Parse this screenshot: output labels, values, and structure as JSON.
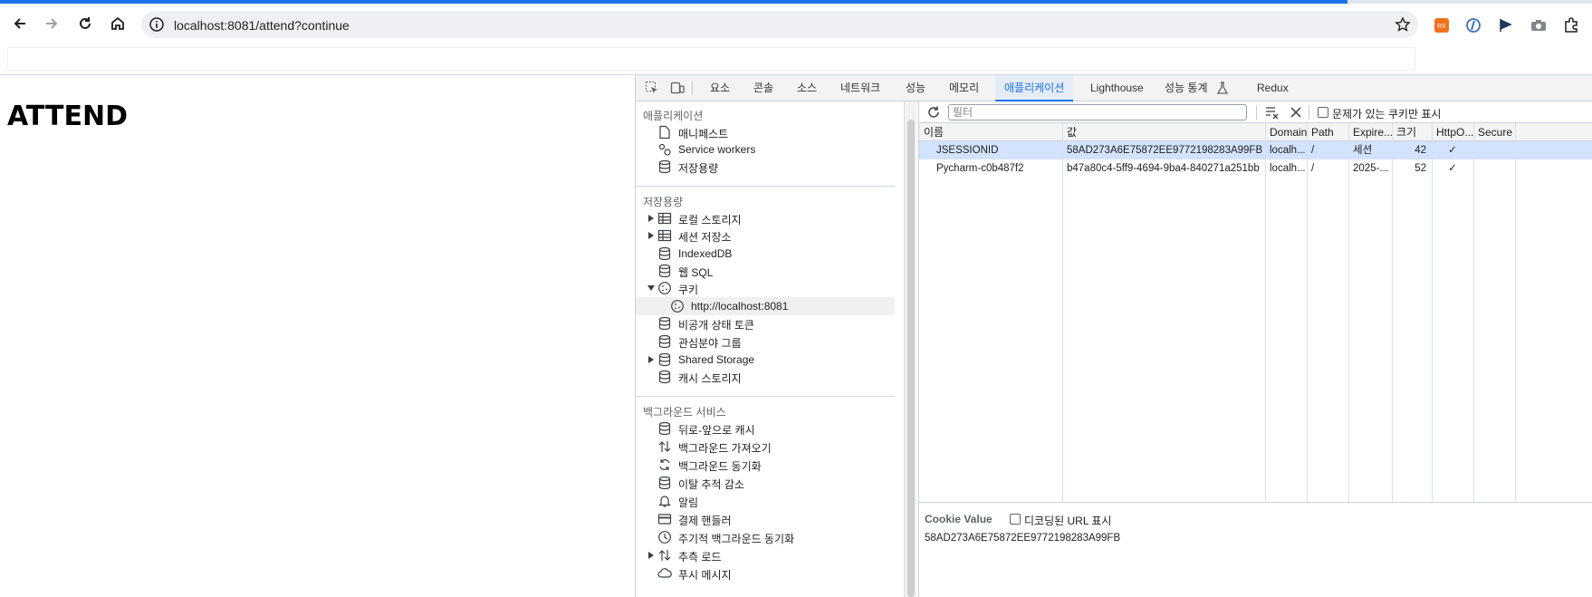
{
  "browser": {
    "url": "localhost:8081/attend?continue",
    "icons": [
      "back-icon",
      "forward-icon",
      "reload-icon",
      "home-icon",
      "info-icon",
      "star-icon",
      "extension-icons",
      "puzzle-icon"
    ]
  },
  "page": {
    "heading": "ATTEND"
  },
  "devtools": {
    "tabs": [
      "요소",
      "콘솔",
      "소스",
      "네트워크",
      "성능",
      "메모리",
      "애플리케이션",
      "Lighthouse",
      "성능 통계",
      "Redux"
    ],
    "active_tab": "애플리케이션",
    "sidebar": {
      "sections": [
        {
          "title": "애플리케이션",
          "items": [
            {
              "label": "매니페스트",
              "icon": "file-icon"
            },
            {
              "label": "Service workers",
              "icon": "gears-icon"
            },
            {
              "label": "저장용량",
              "icon": "database-icon"
            }
          ]
        },
        {
          "title": "저장용량",
          "items": [
            {
              "label": "로컬 스토리지",
              "icon": "table-icon",
              "expandable": true
            },
            {
              "label": "세션 저장소",
              "icon": "table-icon",
              "expandable": true
            },
            {
              "label": "IndexedDB",
              "icon": "database-icon"
            },
            {
              "label": "웹 SQL",
              "icon": "database-icon"
            },
            {
              "label": "쿠키",
              "icon": "cookie-icon",
              "expanded": true
            },
            {
              "label": "http://localhost:8081",
              "icon": "cookie-icon",
              "child": true,
              "selected": true
            },
            {
              "label": "비공개 상태 토큰",
              "icon": "database-icon"
            },
            {
              "label": "관심분야 그룹",
              "icon": "database-icon"
            },
            {
              "label": "Shared Storage",
              "icon": "database-icon",
              "expandable": true
            },
            {
              "label": "캐시 스토리지",
              "icon": "database-icon"
            }
          ]
        },
        {
          "title": "백그라운드 서비스",
          "items": [
            {
              "label": "뒤로-앞으로 캐시",
              "icon": "database-icon"
            },
            {
              "label": "백그라운드 가져오기",
              "icon": "updown-icon"
            },
            {
              "label": "백그라운드 동기화",
              "icon": "sync-icon"
            },
            {
              "label": "이탈 추적 감소",
              "icon": "database-icon"
            },
            {
              "label": "알림",
              "icon": "bell-icon"
            },
            {
              "label": "결제 핸들러",
              "icon": "card-icon"
            },
            {
              "label": "주기적 백그라운드 동기화",
              "icon": "clock-icon"
            },
            {
              "label": "추측 로드",
              "icon": "updown-icon",
              "expandable": true
            },
            {
              "label": "푸시 메시지",
              "icon": "cloud-icon"
            }
          ]
        }
      ]
    },
    "cookies": {
      "filter_placeholder": "필터",
      "only_issues_label": "문제가 있는 쿠키만 표시",
      "columns": [
        "이름",
        "값",
        "Domain",
        "Path",
        "Expire...",
        "크기",
        "HttpO...",
        "Secure"
      ],
      "rows": [
        {
          "name": "JSESSIONID",
          "value": "58AD273A6E75872EE9772198283A99FB",
          "domain": "localh...",
          "path": "/",
          "expires": "세션",
          "size": "42",
          "httponly": "✓",
          "secure": ""
        },
        {
          "name": "Pycharm-c0b487f2",
          "value": "b47a80c4-5ff9-4694-9ba4-840271a251bb",
          "domain": "localh...",
          "path": "/",
          "expires": "2025-...",
          "size": "52",
          "httponly": "✓",
          "secure": ""
        }
      ],
      "cookie_value_title": "Cookie Value",
      "decoded_label": "디코딩된 URL 표시",
      "cookie_value": "58AD273A6E75872EE9772198283A99FB"
    }
  },
  "colors": {
    "accent": "#1a73e8",
    "selected_row": "#d3e3fd"
  }
}
